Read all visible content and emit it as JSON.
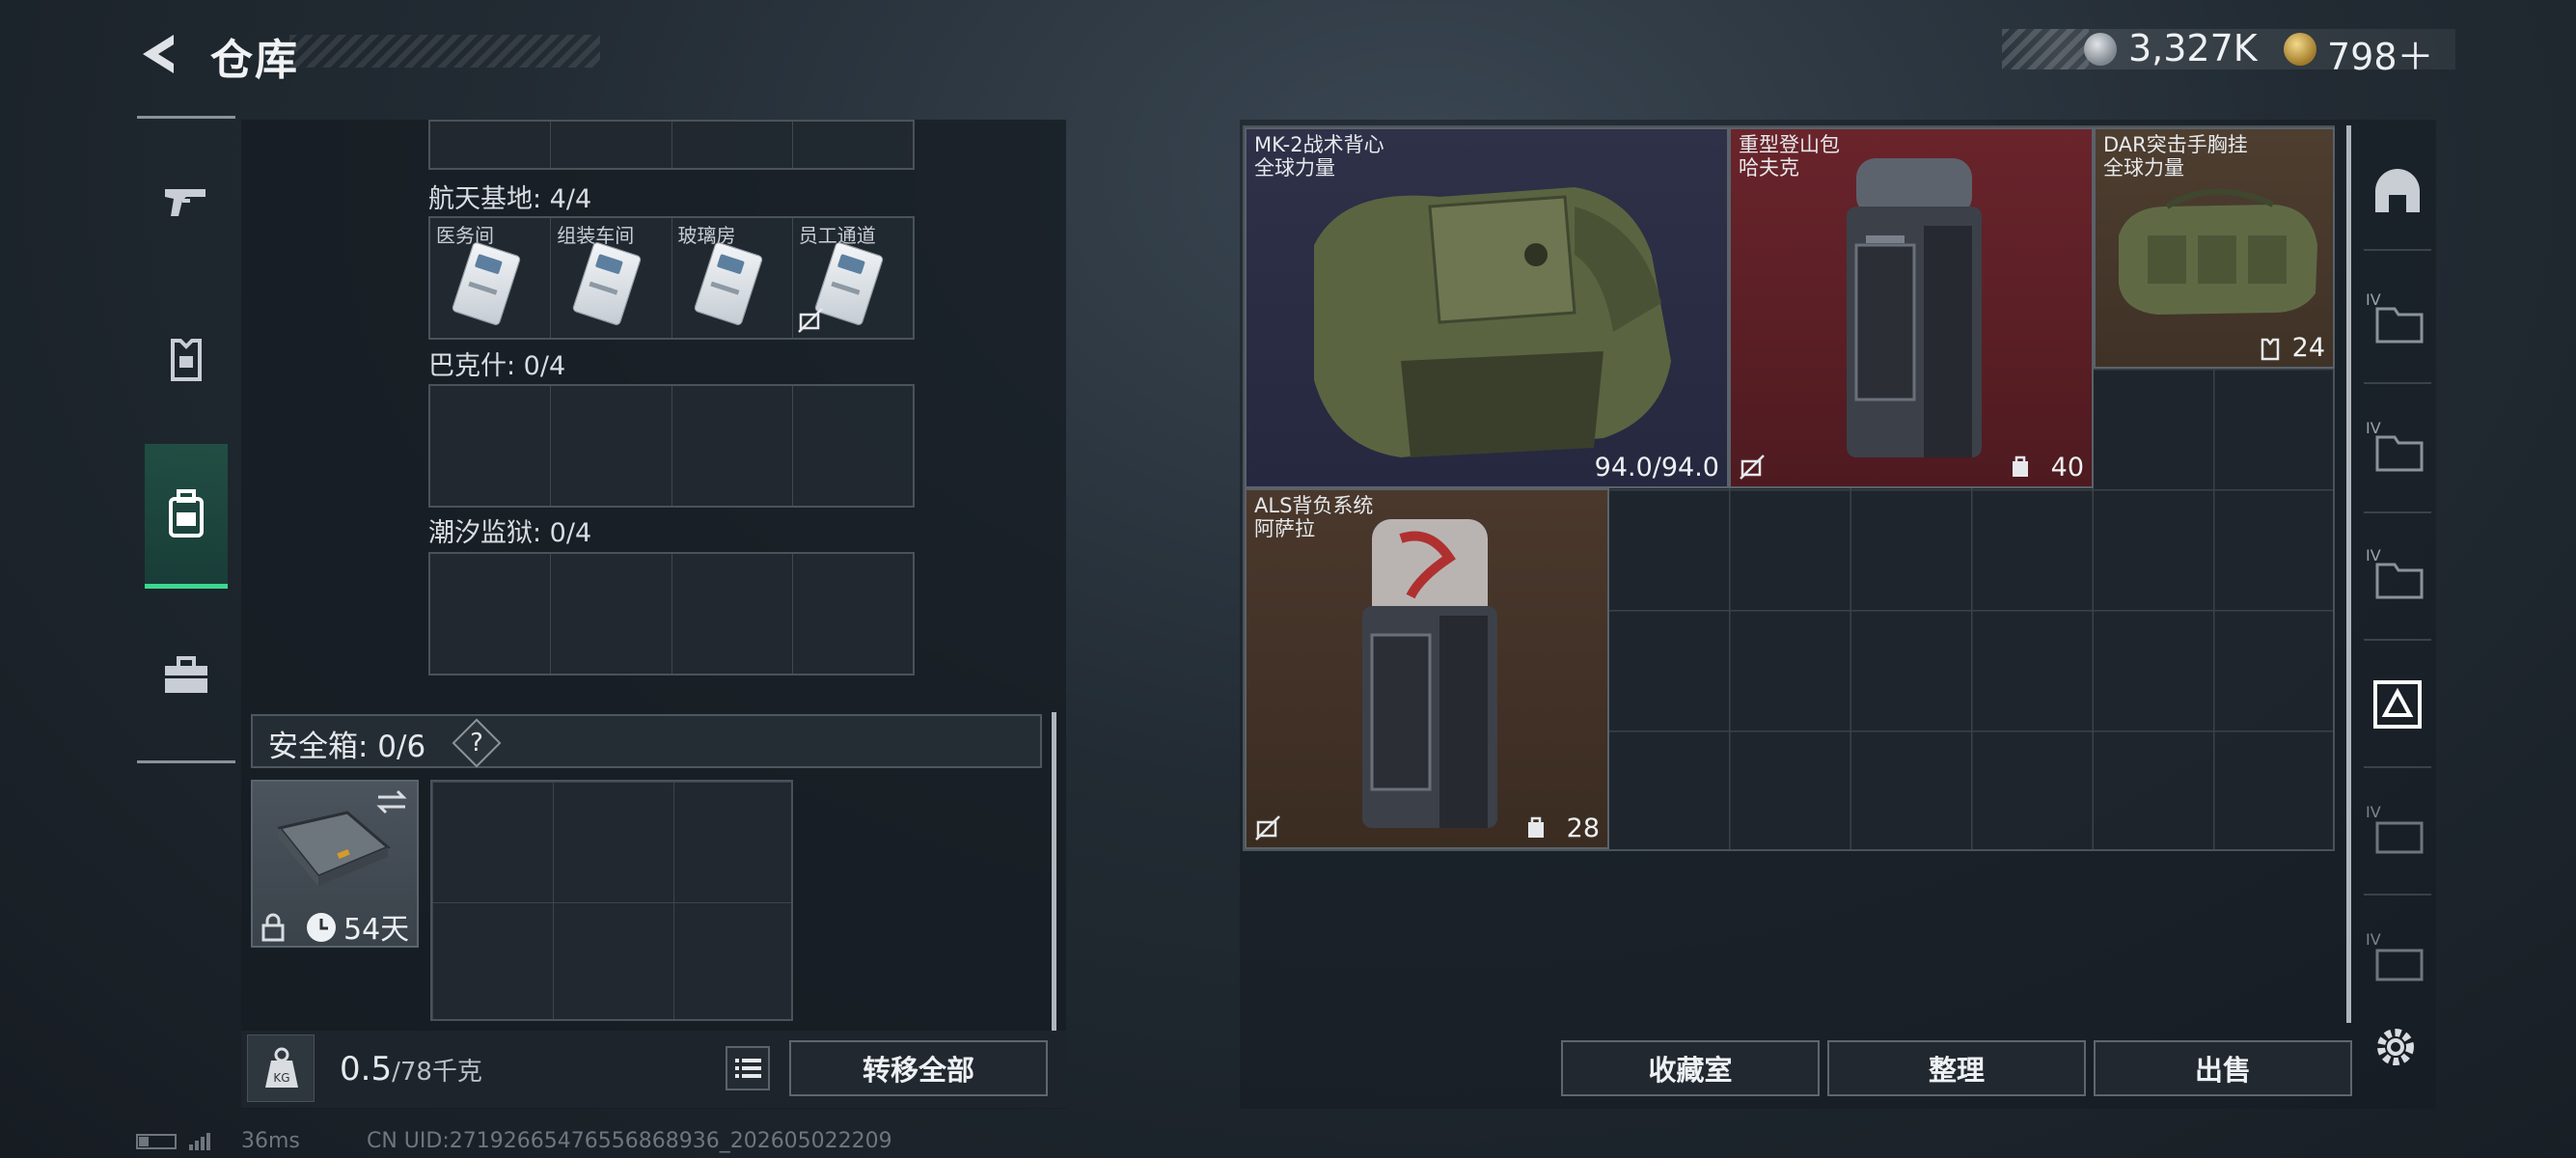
{
  "header": {
    "title": "仓库"
  },
  "currency": {
    "silver": "3,327K",
    "gold": "798＋"
  },
  "storage": {
    "sections": [
      {
        "label": "航天基地: 4/4",
        "cells": [
          "医务间",
          "组装车间",
          "玻璃房",
          "员工通道"
        ]
      },
      {
        "label": "巴克什: 0/4",
        "cells": []
      },
      {
        "label": "潮汐监狱: 0/4",
        "cells": []
      }
    ]
  },
  "safe": {
    "title": "安全箱: 0/6",
    "help": "?",
    "days": "54天"
  },
  "bottom_left": {
    "weight": "0.5",
    "weight_unit": "/78千克",
    "transfer_all": "转移全部"
  },
  "items": [
    {
      "name": "MK-2战术背心",
      "brand": "全球力量",
      "stat": "94.0/94.0"
    },
    {
      "name": "重型登山包",
      "brand": "哈夫克",
      "stat": "40"
    },
    {
      "name": "DAR突击手胸挂",
      "brand": "全球力量",
      "stat": "24"
    },
    {
      "name": "ALS背负系统",
      "brand": "阿萨拉",
      "stat": "28"
    }
  ],
  "bottom_right": {
    "collection": "收藏室",
    "organize": "整理",
    "sell": "出售"
  },
  "side_tabs": {
    "tier_label": "IV"
  },
  "footer": {
    "ping": "36ms",
    "uid": "CN UID:27192665476556868936_202605022209"
  },
  "colors": {
    "active_nav": "#3dd88f",
    "vest_bg": "#2c2e44",
    "backpack_bg": "#5a1e24",
    "rig_bg": "#4a3a2c",
    "als_bg": "#45342a"
  }
}
